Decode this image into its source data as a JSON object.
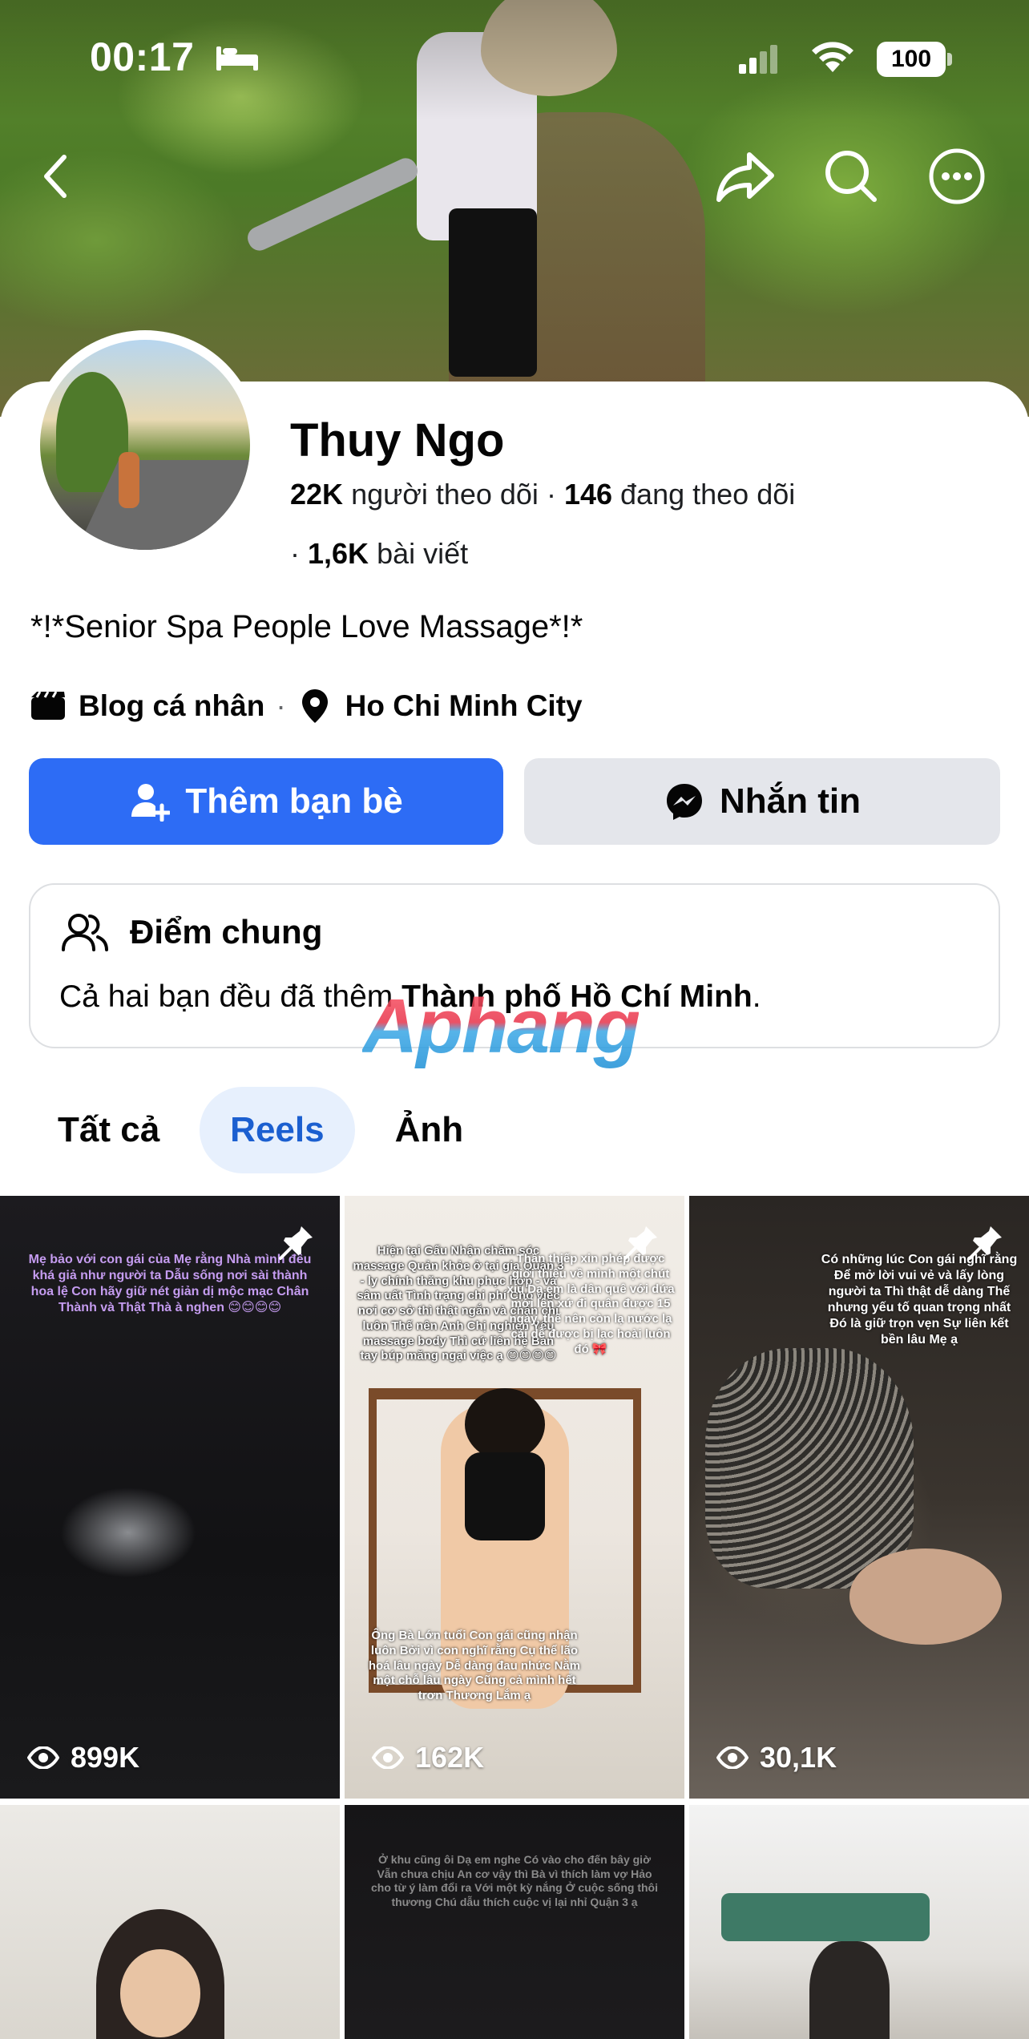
{
  "status_bar": {
    "time": "00:17",
    "battery": "100"
  },
  "profile": {
    "name": "Thuy Ngo",
    "followers_count": "22K",
    "followers_label": "người theo dõi",
    "following_count": "146",
    "following_label": "đang theo dõi",
    "posts_prefix": "·",
    "posts_count": "1,6K",
    "posts_label": "bài viết",
    "bio": "*!*Senior Spa People Love Massage*!*",
    "category": "Blog cá nhân",
    "location": "Ho Chi Minh City"
  },
  "actions": {
    "add_friend": "Thêm bạn bè",
    "message": "Nhắn tin"
  },
  "mutual": {
    "title": "Điểm chung",
    "text_prefix": "Cả hai bạn đều đã thêm ",
    "text_bold": "Thành phố Hồ Chí Minh",
    "text_suffix": "."
  },
  "watermark": "Aphang",
  "tabs": [
    {
      "label": "Tất cả",
      "active": false
    },
    {
      "label": "Reels",
      "active": true
    },
    {
      "label": "Ảnh",
      "active": false
    }
  ],
  "reels": [
    {
      "views": "899K",
      "pinned": true,
      "caption": "Mẹ bảo với con gái của Mẹ rằng Nhà mình đều khá giả như người ta Dẫu sống nơi sài thành hoa lệ Con hãy giữ nét giản dị mộc mạc Chân Thành và Thật Thà à nghen 😊😊😊😊"
    },
    {
      "views": "162K",
      "pinned": true,
      "caption": "Hiện tại Gấu Nhận chăm sóc massage Quản khỏe ở tại gia Quận 3 - ly chính thăng khu phục hợp - và sâm uất Tình trạng chi phí Cho việc nơi cơ sở thì thật ngắn và chân chỉ luôn Thế nên Anh Chị nghiện Yêu massage body Thì cứ liên hệ Bản tay búp măng ngại việc ạ 😊😊😊😊",
      "caption_b": "Thần thiếp xin phép được giới thiệu về mình một chút xíu Dạ em là dân quê với dứa mới lên xứ đi quân được 15 ngày, thế nên còn lạ nước lạ cái dễ được bị lạc hoài luôn đó 🎀",
      "caption_c": "Ông Bà Lớn tuổi Con gái cũng nhận luôn Bởi vì con nghĩ rằng Cụ thể lão hoá lâu ngày Dễ dàng đau nhức Nằm một chỗ lâu ngày Cũng cả mình hết trơn Thương Lắm ạ"
    },
    {
      "views": "30,1K",
      "pinned": true,
      "caption": "Có những lúc Con gái nghĩ rằng Để mở lời vui vẻ và lấy lòng người ta Thì thật dễ dàng Thế nhưng yếu tố quan trọng nhất Đó là giữ trọn vẹn Sự liên kết bền lâu Mẹ ạ"
    },
    {
      "views": "",
      "pinned": false,
      "caption": ""
    },
    {
      "views": "",
      "pinned": false,
      "caption": "Ở khu cũng ôi Dạ em nghe Có vào cho đến bây giờ Vẫn chưa chịu An cơ vậy thì Bà vì thích làm vợ Hảo cho từ ý làm đổi ra Với một kỳ nắng Ở cuộc sống thôi thương Chú dẫu thích cuộc vị lại nhỉ Quận 3 ạ"
    },
    {
      "views": "",
      "pinned": false,
      "caption": ""
    }
  ],
  "colors": {
    "primary_button": "#2d6cf5",
    "secondary_button": "#e4e6eb",
    "active_tab_bg": "#e7f0fd",
    "active_tab_text": "#1b5fd0"
  }
}
